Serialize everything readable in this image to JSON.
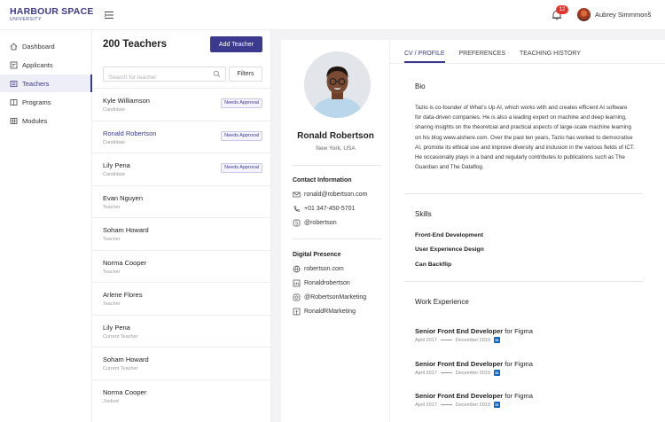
{
  "brand": {
    "name": "HARBOUR SPACE",
    "sub": "UNIVERSITY"
  },
  "topbar": {
    "notification_count": "12",
    "user_name": "Aubrey Simmmons"
  },
  "sidebar": {
    "items": [
      {
        "label": "Dashboard",
        "icon": "home-icon"
      },
      {
        "label": "Applicants",
        "icon": "applicants-icon"
      },
      {
        "label": "Teachers",
        "icon": "teachers-icon"
      },
      {
        "label": "Programs",
        "icon": "programs-icon"
      },
      {
        "label": "Modules",
        "icon": "modules-icon"
      }
    ]
  },
  "list": {
    "title": "200 Teachers",
    "add_label": "Add Teacher",
    "search_placeholder": "Search for teacher",
    "filters_label": "Filters",
    "rows": [
      {
        "name": "Kyle Williamson",
        "role": "Candidate",
        "badge": "Needs Approval"
      },
      {
        "name": "Ronald Robertson",
        "role": "Candidate",
        "badge": "Needs Approval"
      },
      {
        "name": "Lily Pena",
        "role": "Candidate",
        "badge": "Needs Approval"
      },
      {
        "name": "Evan Nguyen",
        "role": "Teacher"
      },
      {
        "name": "Soham Howard",
        "role": "Teacher"
      },
      {
        "name": "Norma Cooper",
        "role": "Teacher"
      },
      {
        "name": "Arlene Flores",
        "role": "Teacher"
      },
      {
        "name": "Lily Pena",
        "role": "Current Teacher"
      },
      {
        "name": "Soham Howard",
        "role": "Current Teacher"
      },
      {
        "name": "Norma Cooper",
        "role": "Junked"
      }
    ]
  },
  "profile": {
    "name": "Ronald Robertson",
    "location": "New York, USA",
    "contact_heading": "Contact Information",
    "email": "ronald@robertson.com",
    "phone": "+01 347-450-5701",
    "skype": "@robertson",
    "digital_heading": "Digital Presence",
    "website": "robertson.com",
    "linkedin": "Ronaldrobertson",
    "instagram": "@RobertsonMarketing",
    "facebook": "RonaldRMarketing"
  },
  "tabs": [
    "CV / PROFILE",
    "PREFERENCES",
    "TEACHING HISTORY"
  ],
  "cv": {
    "bio_heading": "Bio",
    "bio": "Tazio is co-founder of What’s Up AI, which works with and creates efficient AI software for data-driven companies.  He is also a leading expert on machine and deep learning, sharing insights on the theoretcial and practical aspects of large-scale machine learning on his blog www.aishere.com.  Over the past ten years, Tazio has worked to democratise AI, promote its ethical use and improve diversity and inclusion in the various fields of ICT.  He occasionally plays in a band and regularly contributes to publications such as The Guardian and The Dataflog.",
    "skills_heading": "Skills",
    "skills": [
      "Front-End Development",
      "User Experience Design",
      "Can Backflip"
    ],
    "work_heading": "Work Experience",
    "jobs": [
      {
        "title": "Senior Front End Developer",
        "for": "for",
        "company": "Figma",
        "start": "April 2017",
        "end": "December 2019"
      },
      {
        "title": "Senior Front End Developer",
        "for": "for",
        "company": "Figma",
        "start": "April 2017",
        "end": "December 2019"
      },
      {
        "title": "Senior Front End Developer",
        "for": "for",
        "company": "Figma",
        "start": "April 2017",
        "end": "December 2019"
      }
    ]
  },
  "colors": {
    "accent": "#3b3a8f",
    "badge_red": "#e3342f",
    "linkedin": "#0a66c2"
  }
}
